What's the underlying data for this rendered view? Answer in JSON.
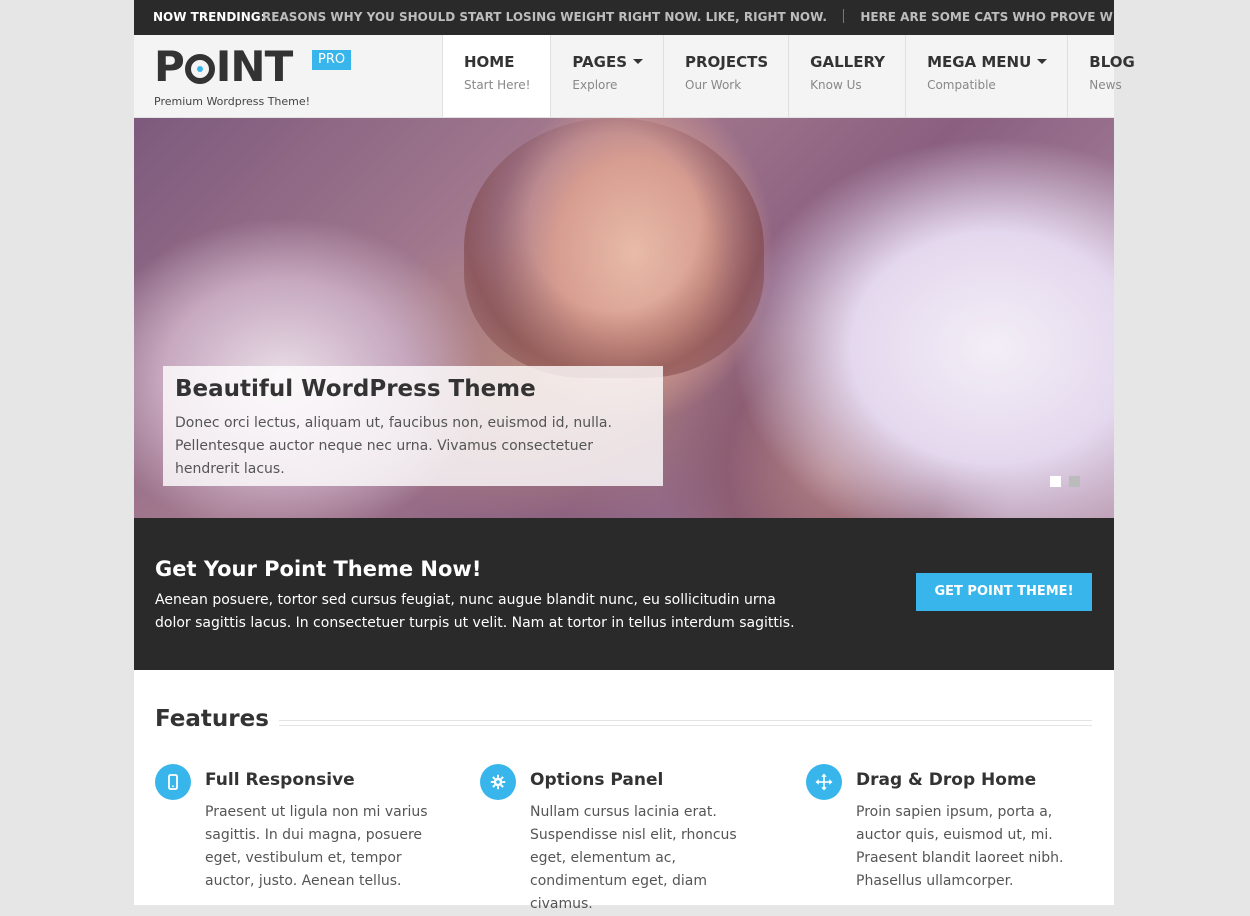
{
  "trending": {
    "label": "NOW TRENDING:",
    "items": [
      "REASONS WHY YOU SHOULD START LOSING WEIGHT RIGHT NOW. LIKE, RIGHT NOW.",
      "HERE ARE SOME CATS WHO PROVE WHY THEY AREN'T CONSIDERED"
    ]
  },
  "logo": {
    "word_start": "P",
    "word_end": "INT",
    "badge": "PRO",
    "tagline": "Premium Wordpress Theme!"
  },
  "nav": [
    {
      "title": "HOME",
      "sub": "Start Here!",
      "active": true,
      "dropdown": false
    },
    {
      "title": "PAGES",
      "sub": "Explore",
      "active": false,
      "dropdown": true
    },
    {
      "title": "PROJECTS",
      "sub": "Our Work",
      "active": false,
      "dropdown": false
    },
    {
      "title": "GALLERY",
      "sub": "Know Us",
      "active": false,
      "dropdown": false
    },
    {
      "title": "MEGA MENU",
      "sub": "Compatible",
      "active": false,
      "dropdown": true
    },
    {
      "title": "BLOG",
      "sub": "News",
      "active": false,
      "dropdown": false
    }
  ],
  "slider": {
    "title": "Beautiful WordPress Theme",
    "text": "Donec orci lectus, aliquam ut, faucibus non, euismod id, nulla. Pellentesque auctor neque nec urna. Vivamus consectetuer hendrerit lacus.",
    "slides_total": 2,
    "active_slide": 1
  },
  "cta": {
    "title": "Get Your Point Theme Now!",
    "text": "Aenean posuere, tortor sed cursus feugiat, nunc augue blandit nunc, eu sollicitudin urna dolor sagittis lacus. In consectetuer turpis ut velit. Nam at tortor in tellus interdum sagittis.",
    "button": "GET POINT THEME!"
  },
  "features": {
    "heading": "Features",
    "items": [
      {
        "icon": "mobile-icon",
        "title": "Full Responsive",
        "text": "Praesent ut ligula non mi varius sagittis. In dui magna, posuere eget, vestibulum et, tempor auctor, justo. Aenean tellus."
      },
      {
        "icon": "gear-icon",
        "title": "Options Panel",
        "text": "Nullam cursus lacinia erat. Suspendisse nisl elit, rhoncus eget, elementum ac, condimentum eget, diam civamus."
      },
      {
        "icon": "move-arrows-icon",
        "title": "Drag & Drop Home",
        "text": "Proin sapien ipsum, porta a, auctor quis, euismod ut, mi. Praesent blandit laoreet nibh. Phasellus ullamcorper."
      }
    ]
  },
  "colors": {
    "accent": "#38b6eb",
    "dark": "#2a2a2a",
    "header_bg": "#f4f4f4",
    "page_bg": "#e6e6e6"
  }
}
